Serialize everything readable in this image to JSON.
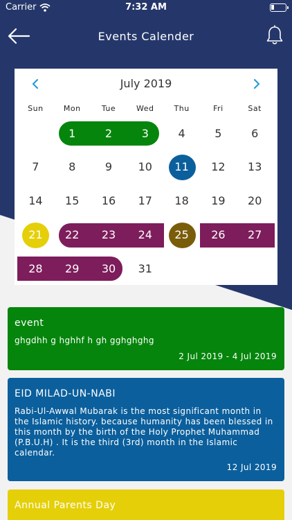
{
  "status_bar": {
    "carrier": "Carrier",
    "time": "7:32 AM"
  },
  "header": {
    "title": "Events Calender"
  },
  "calendar": {
    "month_label": "July 2019",
    "weekdays": [
      "Sun",
      "Mon",
      "Tue",
      "Wed",
      "Thu",
      "Fri",
      "Sat"
    ],
    "days": [
      "1",
      "2",
      "3",
      "4",
      "5",
      "6",
      "7",
      "8",
      "9",
      "10",
      "11",
      "12",
      "13",
      "14",
      "15",
      "16",
      "17",
      "18",
      "19",
      "20",
      "21",
      "22",
      "23",
      "24",
      "25",
      "26",
      "27",
      "28",
      "29",
      "30",
      "31"
    ],
    "highlights": {
      "green_range": [
        "1",
        "3"
      ],
      "blue_day": "11",
      "yellow_day": "21",
      "purple_ranges": [
        [
          "22",
          "24"
        ],
        [
          "26",
          "27"
        ],
        [
          "28",
          "30"
        ]
      ],
      "olive_day": "25"
    }
  },
  "events": [
    {
      "title": "event",
      "description": "ghgdhh g hghhf  h gh gghghghg",
      "date": "2 Jul 2019 - 4 Jul 2019"
    },
    {
      "title": "EID MILAD-UN-NABI",
      "description": "Rabi-Ul-Awwal Mubarak is the most significant month in the Islamic history. because humanity has been blessed in this month by the birth of the Holy Prophet Muhammad (P.B.U.H) . It is the third (3rd) month in the Islamic calendar.",
      "date": "12 Jul 2019"
    },
    {
      "title": "Annual Parents Day",
      "description": "",
      "date": ""
    }
  ],
  "colors": {
    "navy": "#25376a",
    "green": "#05850c",
    "blue": "#0b5f9c",
    "purple": "#7d1d5c",
    "yellow": "#e5cf09",
    "olive": "#7a5d0b",
    "arrow_blue": "#1d9bd8"
  },
  "icons": [
    "back-arrow-icon",
    "bell-icon",
    "wifi-icon",
    "battery-icon",
    "chevron-left-icon",
    "chevron-right-icon"
  ]
}
